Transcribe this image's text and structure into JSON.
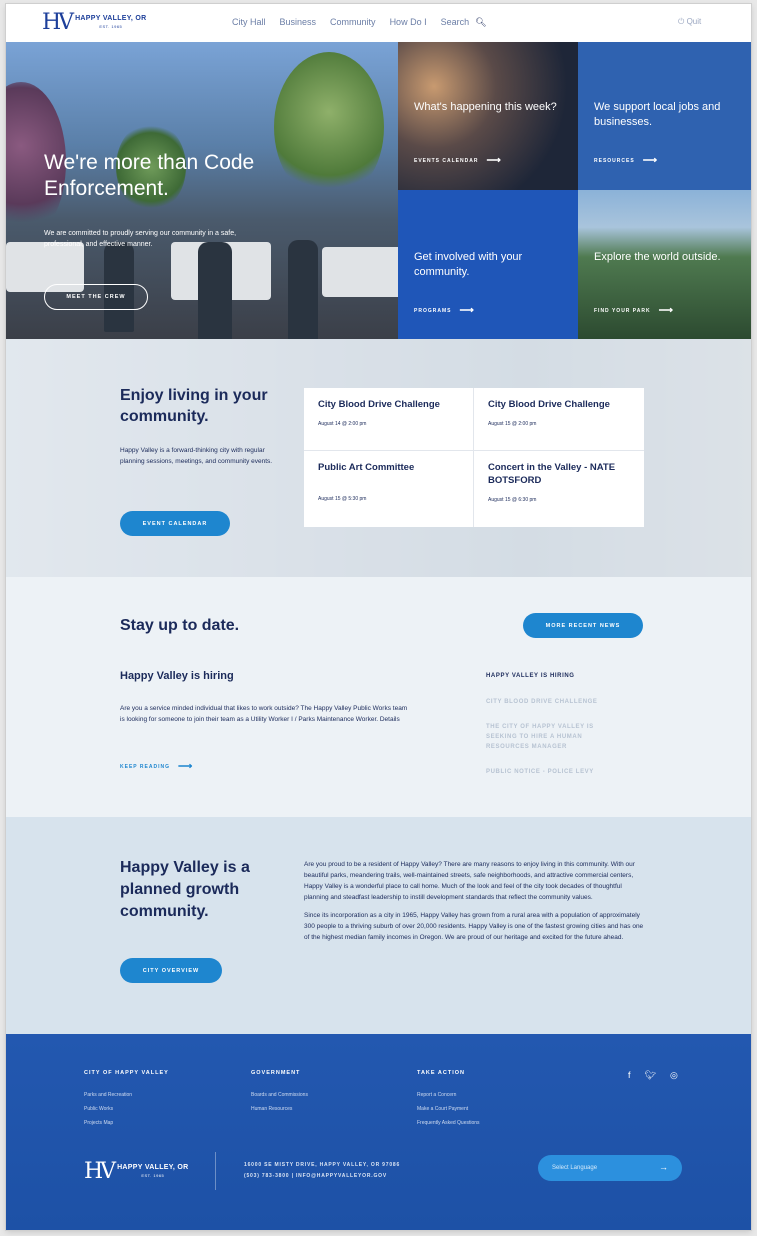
{
  "header": {
    "logo_mark": "HV",
    "logo_name": "HAPPY VALLEY, OR",
    "logo_est": "EST. 1965",
    "nav": [
      "City Hall",
      "Business",
      "Community",
      "How Do I",
      "Search"
    ],
    "login": "Quit"
  },
  "hero": {
    "title": "We're more than Code Enforcement.",
    "text": "We are committed to proudly serving our community in a safe, professional, and effective manner.",
    "button": "MEET THE CREW"
  },
  "tiles": [
    {
      "title": "What's happening this week?",
      "link": "EVENTS CALENDAR"
    },
    {
      "title": "We support local jobs and businesses.",
      "link": "RESOURCES"
    },
    {
      "title": "Get involved with your community.",
      "link": "PROGRAMS"
    },
    {
      "title": "Explore the world outside.",
      "link": "FIND YOUR PARK"
    }
  ],
  "events": {
    "title": "Enjoy living in your community.",
    "text": "Happy Valley is a forward-thinking city with regular planning sessions, meetings, and community events.",
    "button": "EVENT CALENDAR",
    "items": [
      {
        "name": "City Blood Drive Challenge",
        "date": "August 14 @ 2:00 pm"
      },
      {
        "name": "City Blood Drive Challenge",
        "date": "August 15 @ 2:00 pm"
      },
      {
        "name": "Public Art Committee",
        "date": "August 15 @ 5:30 pm"
      },
      {
        "name": "Concert in the Valley - NATE BOTSFORD",
        "date": "August 15 @ 6:30 pm"
      }
    ]
  },
  "news": {
    "title": "Stay up to date.",
    "button": "MORE RECENT NEWS",
    "post_title": "Happy Valley is hiring",
    "post_text": "Are you a service minded individual that likes to work outside? The Happy Valley Public Works team is looking for someone to join their team as a Utility Worker I / Parks Maintenance Worker. Details",
    "keep_reading": "KEEP READING",
    "side_links": [
      "HAPPY VALLEY IS HIRING",
      "CITY BLOOD DRIVE CHALLENGE",
      "THE CITY OF HAPPY VALLEY IS SEEKING TO HIRE A HUMAN RESOURCES MANAGER",
      "PUBLIC NOTICE - POLICE LEVY"
    ]
  },
  "growth": {
    "title": "Happy Valley is a planned growth community.",
    "button": "CITY OVERVIEW",
    "p1": "Are you proud to be a resident of Happy Valley? There are many reasons to enjoy living in this community. With our beautiful parks, meandering trails, well-maintained streets, safe neighborhoods, and attractive commercial centers, Happy Valley is a wonderful place to call home. Much of the look and feel of the city took decades of thoughtful planning and steadfast leadership to instill development standards that reflect the community values.",
    "p2": "Since its incorporation as a city in 1965, Happy Valley has grown from a rural area with a population of approximately 300 people to a thriving suburb of over 20,000 residents. Happy Valley is one of the fastest growing cities and has one of the highest median family incomes in Oregon. We are proud of our heritage and excited for the future ahead."
  },
  "footer": {
    "col1": {
      "head": "CITY OF HAPPY VALLEY",
      "links": [
        "Parks and Recreation",
        "Public Works",
        "Projects Map"
      ]
    },
    "col2": {
      "head": "GOVERNMENT",
      "links": [
        "Boards and Commissions",
        "Human Resources"
      ]
    },
    "col3": {
      "head": "TAKE ACTION",
      "links": [
        "Report a Concern",
        "Make a Court Payment",
        "Frequently Asked Questions"
      ]
    },
    "social": [
      "f",
      "t",
      "◎"
    ],
    "address": "16000 SE MISTY DRIVE, HAPPY VALLEY, OR 97086",
    "contact": "(503) 783-3800 | INFO@HAPPYVALLEYOR.GOV",
    "language": "Select Language",
    "logo_name": "HAPPY VALLEY, OR",
    "logo_est": "EST. 1965"
  },
  "colors": {
    "primary": "#1d51a6",
    "accent": "#1e86cf",
    "navy": "#1b2a5a"
  }
}
